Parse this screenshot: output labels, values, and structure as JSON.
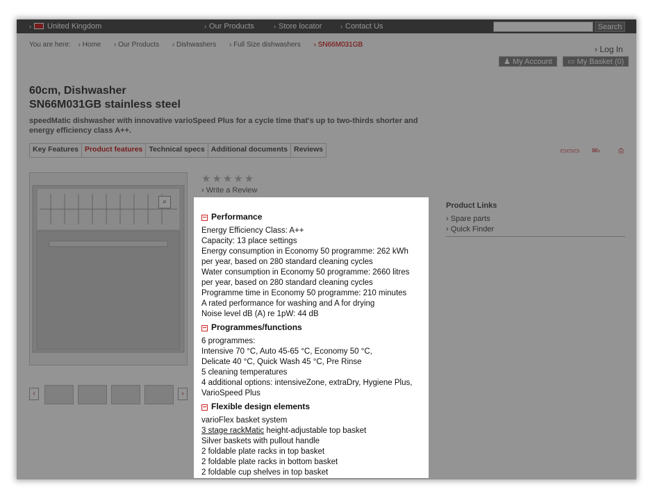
{
  "topbar": {
    "country": "United Kingdom",
    "nav": [
      "Our Products",
      "Store locator",
      "Contact Us"
    ],
    "search_label": "Search"
  },
  "breadcrumb": {
    "prefix": "You are here:",
    "items": [
      "Home",
      "Our Products",
      "Dishwashers",
      "Full Size dishwashers",
      "SN66M031GB"
    ]
  },
  "account": {
    "login": "Log In",
    "my_account": "My Account",
    "my_basket": "My Basket (0)"
  },
  "product": {
    "title_line1": "60cm, Dishwasher",
    "title_line2": "SN66M031GB stainless steel",
    "subtitle": "speedMatic dishwasher with innovative varioSpeed Plus for a cycle time that's up to two-thirds shorter and energy efficiency class A++.",
    "write_review": "Write a Review"
  },
  "tabs": [
    "Key Features",
    "Product features",
    "Technical specs",
    "Additional documents",
    "Reviews"
  ],
  "product_links": {
    "heading": "Product Links",
    "items": [
      "Spare parts",
      "Quick Finder"
    ]
  },
  "features": {
    "performance": {
      "title": "Performance",
      "lines": [
        "Energy Efficiency Class: A++",
        "Capacity: 13 place settings",
        "Energy consumption in Economy 50 programme: 262 kWh",
        "per year, based on 280 standard cleaning cycles",
        "Water consumption in Economy 50 programme: 2660 litres",
        "per year, based on 280 standard cleaning cycles",
        "Programme time in Economy 50 programme: 210 minutes",
        "A rated performance for washing and A for drying",
        "Noise level dB (A) re 1pW: 44 dB"
      ]
    },
    "programmes": {
      "title": "Programmes/functions",
      "lines": [
        "6 programmes:",
        "Intensive 70 °C, Auto 45-65 °C, Economy 50 °C,",
        "Delicate 40 °C, Quick Wash 45 °C, Pre Rinse",
        "5 cleaning temperatures",
        "4 additional options: intensiveZone, extraDry, Hygiene Plus,",
        "VarioSpeed Plus"
      ]
    },
    "design": {
      "title": "Flexible design elements",
      "lines": [
        "varioFlex basket system",
        "height-adjustable top basket",
        "Silver baskets with pullout handle",
        "2 foldable plate racks in top basket",
        "2 foldable plate racks in bottom basket",
        "2 foldable cup shelves in top basket"
      ],
      "rackmatic_link": "3 stage rackMatic"
    }
  },
  "colors": {
    "accent": "#cc2222",
    "overlay": "#6b6b6b"
  }
}
